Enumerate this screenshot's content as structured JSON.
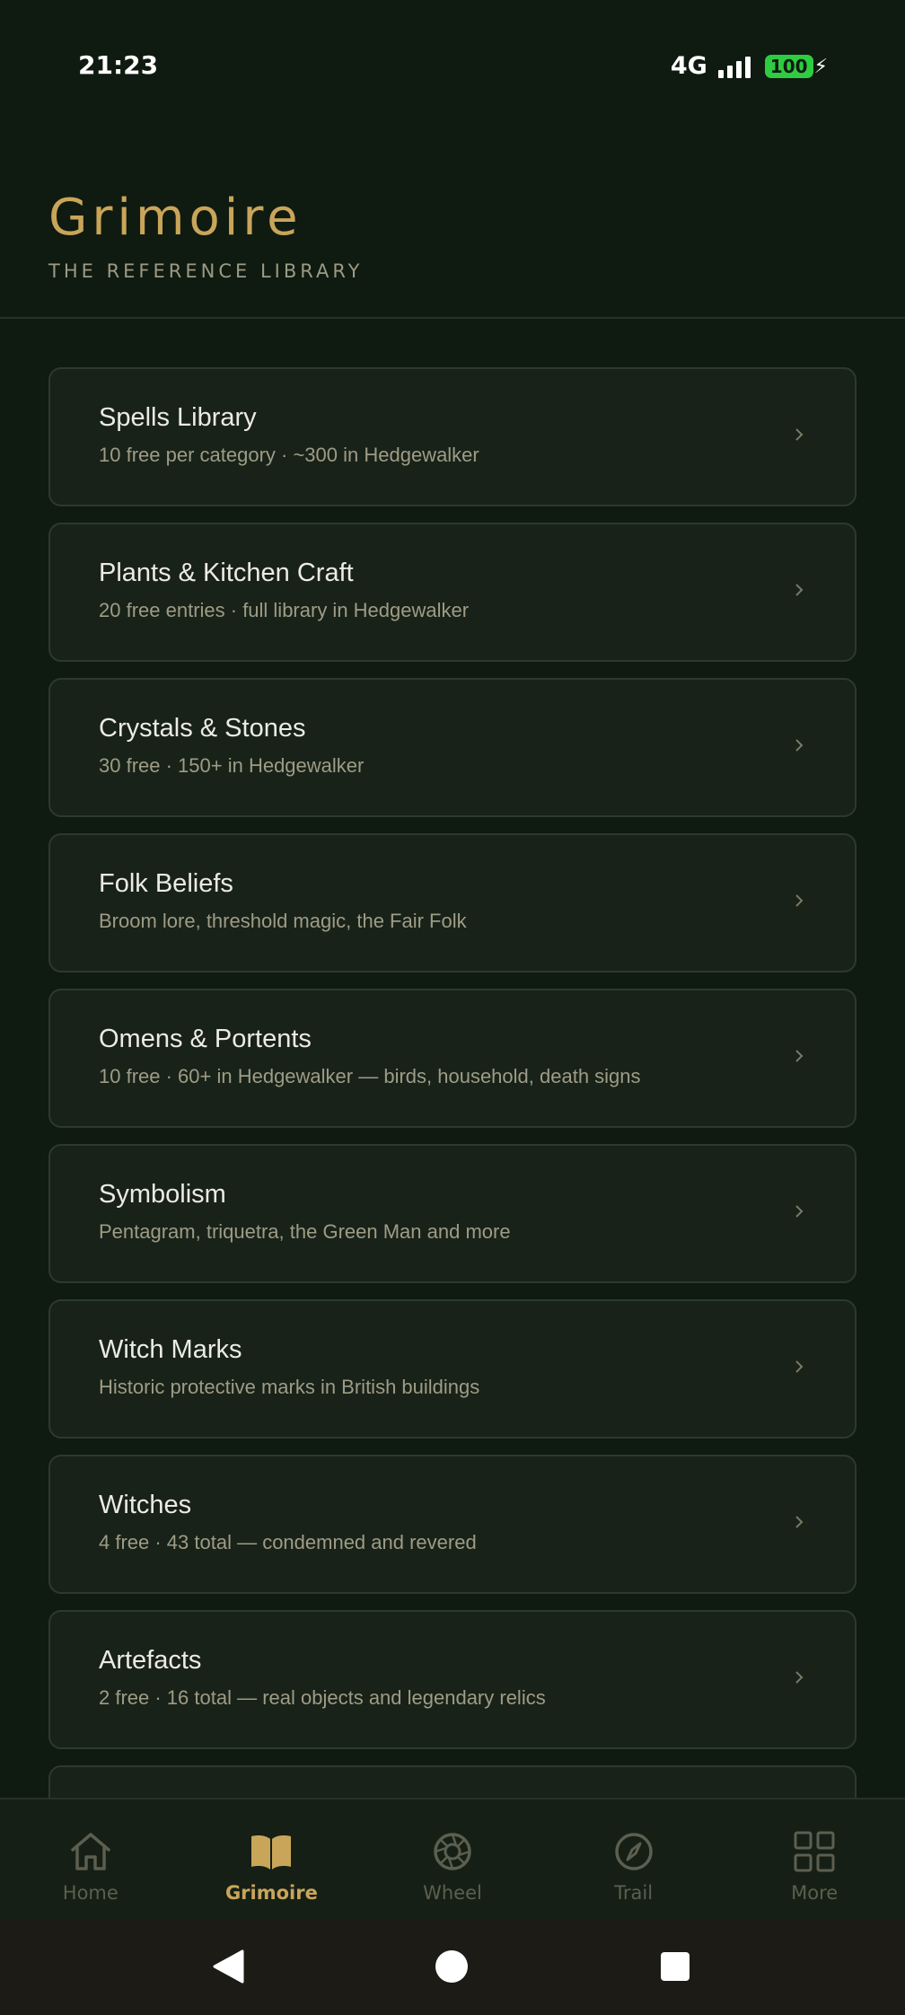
{
  "status_bar": {
    "time": "21:23",
    "network": "4G",
    "battery": "100"
  },
  "header": {
    "title": "Grimoire",
    "subtitle": "THE REFERENCE LIBRARY"
  },
  "items": [
    {
      "title": "Spells Library",
      "subtitle": "10 free per category · ~300 in Hedgewalker"
    },
    {
      "title": "Plants & Kitchen Craft",
      "subtitle": "20 free entries · full library in Hedgewalker"
    },
    {
      "title": "Crystals & Stones",
      "subtitle": "30 free · 150+ in Hedgewalker"
    },
    {
      "title": "Folk Beliefs",
      "subtitle": "Broom lore, threshold magic, the Fair Folk"
    },
    {
      "title": "Omens & Portents",
      "subtitle": "10 free · 60+ in Hedgewalker — birds, household, death signs"
    },
    {
      "title": "Symbolism",
      "subtitle": "Pentagram, triquetra, the Green Man and more"
    },
    {
      "title": "Witch Marks",
      "subtitle": "Historic protective marks in British buildings"
    },
    {
      "title": "Witches",
      "subtitle": "4 free · 43 total — condemned and revered"
    },
    {
      "title": "Artefacts",
      "subtitle": "2 free · 16 total — real objects and legendary relics"
    }
  ],
  "bottom_nav": {
    "items": [
      {
        "label": "Home",
        "icon": "home-icon"
      },
      {
        "label": "Grimoire",
        "icon": "book-icon",
        "active": true
      },
      {
        "label": "Wheel",
        "icon": "wheel-icon"
      },
      {
        "label": "Trail",
        "icon": "compass-icon"
      },
      {
        "label": "More",
        "icon": "grid-icon"
      }
    ]
  },
  "colors": {
    "background": "#0f1a10",
    "accent": "#c9a55a",
    "card": "#182218",
    "card_border": "#2c3a2b",
    "muted": "#9e9c86"
  }
}
